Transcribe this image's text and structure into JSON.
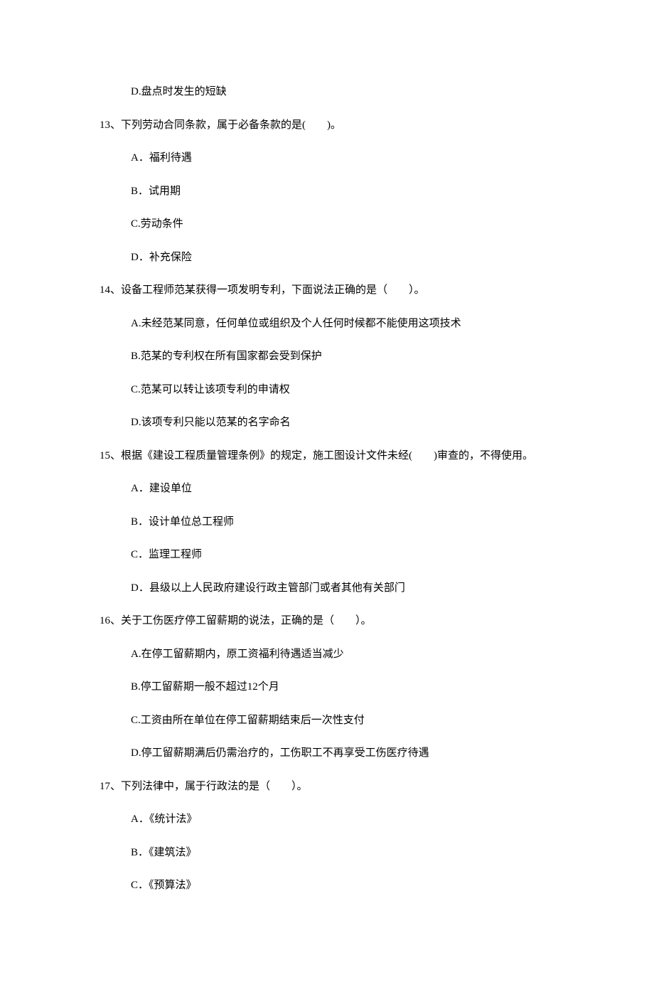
{
  "orphan": {
    "label": "D.盘点时发生的短缺"
  },
  "questions": [
    {
      "number": "13、",
      "text": "下列劳动合同条款，属于必备条款的是(　　)。",
      "options": [
        "A．福利待遇",
        "B．试用期",
        "C.劳动条件",
        "D．补充保险"
      ]
    },
    {
      "number": "14、",
      "text": "设备工程师范某获得一项发明专利，下面说法正确的是（　　）。",
      "options": [
        "A.未经范某同意，任何单位或组织及个人任何时候都不能使用这项技术",
        "B.范某的专利权在所有国家都会受到保护",
        "C.范某可以转让该项专利的申请权",
        "D.该项专利只能以范某的名字命名"
      ]
    },
    {
      "number": "15、",
      "text": "根据《建设工程质量管理条例》的规定，施工图设计文件未经(　　)审查的，不得使用。",
      "options": [
        "A．建设单位",
        "B．设计单位总工程师",
        "C．监理工程师",
        "D．县级以上人民政府建设行政主管部门或者其他有关部门"
      ]
    },
    {
      "number": "16、",
      "text": "关于工伤医疗停工留薪期的说法，正确的是（　　）。",
      "options": [
        "A.在停工留薪期内，原工资福利待遇适当减少",
        "B.停工留薪期一般不超过12个月",
        "C.工资由所在单位在停工留薪期结束后一次性支付",
        "D.停工留薪期满后仍需治疗的，工伤职工不再享受工伤医疗待遇"
      ]
    },
    {
      "number": "17、",
      "text": "下列法律中，属于行政法的是（　　）。",
      "options": [
        "A．《统计法》",
        "B．《建筑法》",
        "C．《预算法》"
      ]
    }
  ]
}
